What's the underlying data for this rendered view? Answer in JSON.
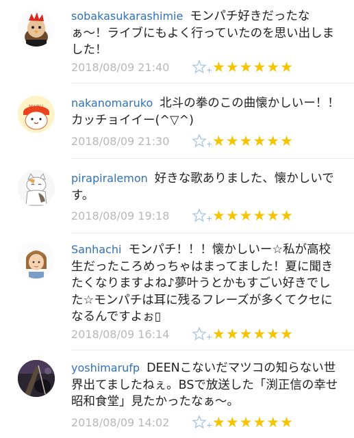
{
  "comments": [
    {
      "user": "sobakasukarashimie",
      "text": "モンパチ好きだったなぁ〜！ライブにもよく行っていたのを思い出しました！",
      "time": "2018/08/09 21:40",
      "rating": "★★★★★★"
    },
    {
      "user": "nakanomaruko",
      "text": "北斗の拳のこの曲懐かしいー！！カッチョイイー(^▽^)",
      "time": "2018/08/09 21:30",
      "rating": "★★★★★★",
      "avatar_label": "MARU"
    },
    {
      "user": "pirapiralemon",
      "text": "好きな歌ありました、懐かしいです。",
      "time": "2018/08/09 19:18",
      "rating": "★★★★★★"
    },
    {
      "user": "Sanhachi",
      "text": "モンパチ！！！懐かしいー☆私が高校生だったころめっちゃはまってました！夏に聞きたくなりますよね♪夢叶うとかもすごい好きでした☆モンパチは耳に残るフレーズが多くてクセになるんですよぉ▯",
      "time": "2018/08/09 16:14",
      "rating": "★★★★★★"
    },
    {
      "user": "yoshimarufp",
      "text": "DEENこないだマツコの知らない世界出てましたねぇ。BSで放送した「渕正信の幸せ昭和食堂」見たかったなぁ〜。",
      "time": "2018/08/09 14:02",
      "rating": "★★★★★★"
    }
  ],
  "colors": {
    "username": "#2f72b8",
    "star": "#f5c400",
    "timestamp": "#b8b8b8"
  },
  "icons": {
    "favorite": "star-plus-icon"
  }
}
